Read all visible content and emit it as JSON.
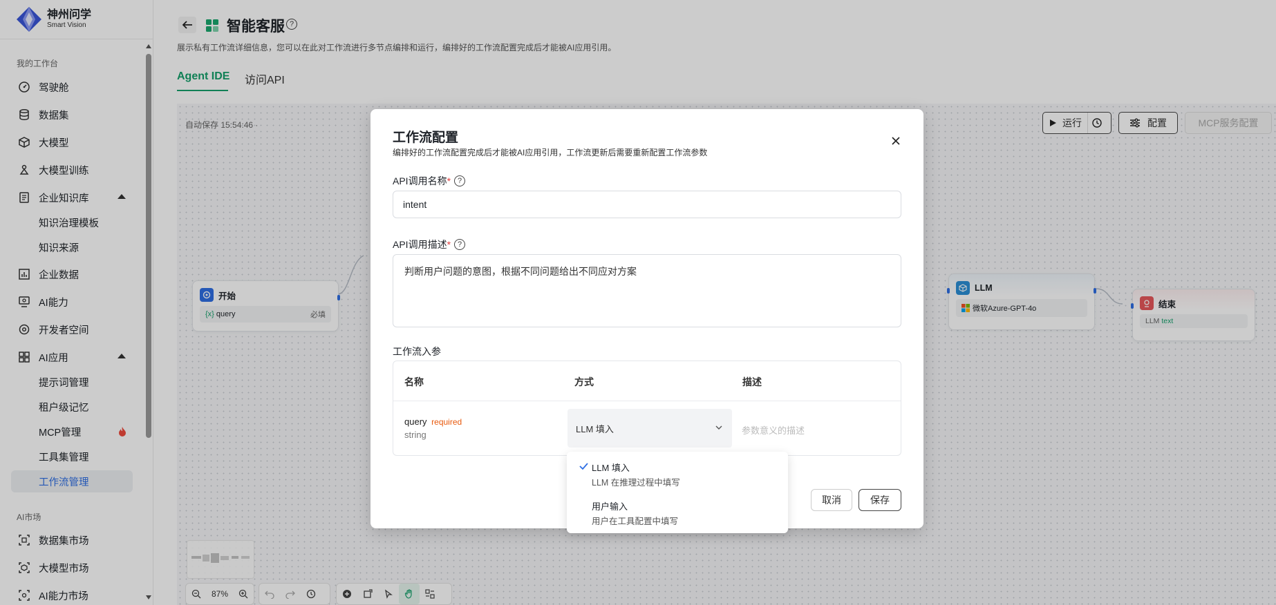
{
  "brand": {
    "name_cn": "神州问学",
    "name_en": "Smart Vision"
  },
  "sidebar": {
    "section_workbench": "我的工作台",
    "items": [
      {
        "label": "驾驶舱",
        "icon": "dashboard-icon"
      },
      {
        "label": "数据集",
        "icon": "database-icon"
      },
      {
        "label": "大模型",
        "icon": "cube-icon"
      },
      {
        "label": "大模型训练",
        "icon": "training-icon"
      },
      {
        "label": "企业知识库",
        "icon": "knowledge-icon",
        "expanded": true
      },
      {
        "label": "知识治理模板",
        "sub": true
      },
      {
        "label": "知识来源",
        "sub": true
      },
      {
        "label": "企业数据",
        "icon": "chart-icon"
      },
      {
        "label": "AI能力",
        "icon": "ai-ability-icon"
      },
      {
        "label": "开发者空间",
        "icon": "developer-icon"
      },
      {
        "label": "AI应用",
        "icon": "apps-icon",
        "expanded": true
      },
      {
        "label": "提示词管理",
        "sub": true
      },
      {
        "label": "租户级记忆",
        "sub": true
      },
      {
        "label": "MCP管理",
        "sub": true,
        "badge": "fire-icon"
      },
      {
        "label": "工具集管理",
        "sub": true
      },
      {
        "label": "工作流管理",
        "sub": true,
        "active": true
      }
    ],
    "section_market": "AI市场",
    "market": [
      {
        "label": "数据集市场",
        "icon": "dataset-market-icon"
      },
      {
        "label": "大模型市场",
        "icon": "model-market-icon"
      },
      {
        "label": "AI能力市场",
        "icon": "ability-market-icon"
      }
    ]
  },
  "header": {
    "title": "智能客服",
    "description": "展示私有工作流详细信息，您可以在此对工作流进行多节点编排和运行，编排好的工作流配置完成后才能被AI应用引用。",
    "tabs": [
      {
        "label": "Agent IDE",
        "active": true
      },
      {
        "label": "访问API",
        "active": false
      }
    ]
  },
  "canvas": {
    "autosave": "自动保存 15:54:46 ·",
    "toolbar": {
      "run": "运行",
      "config": "配置",
      "mcp": "MCP服务配置"
    },
    "nodes": {
      "start": {
        "title": "开始",
        "param": "query",
        "tag": "必填",
        "param_prefix": "{x}"
      },
      "llm": {
        "title": "LLM",
        "model": "微软Azure-GPT-4o"
      },
      "end": {
        "title": "结束",
        "output_src": "LLM",
        "output_var": "text"
      }
    },
    "zoom": "87%"
  },
  "modal": {
    "title": "工作流配置",
    "subtitle": "编排好的工作流配置完成后才能被AI应用引用，工作流更新后需要重新配置工作流参数",
    "api_name_label": "API调用名称",
    "api_name_value": "intent",
    "api_desc_label": "API调用描述",
    "api_desc_value": "判断用户问题的意图，根据不同问题给出不同应对方案",
    "params_label": "工作流入参",
    "table": {
      "headers": [
        "名称",
        "方式",
        "描述"
      ],
      "row": {
        "name": "query",
        "required": "required",
        "type": "string",
        "mode": "LLM 填入",
        "desc_placeholder": "参数意义的描述"
      }
    },
    "cancel": "取消",
    "save": "保存",
    "dropdown": [
      {
        "title": "LLM 填入",
        "desc": "LLM 在推理过程中填写",
        "selected": true
      },
      {
        "title": "用户输入",
        "desc": "用户在工具配置中填写",
        "selected": false
      }
    ]
  },
  "colors": {
    "accent": "#14a06b",
    "active_nav": "#2f6fe4",
    "required": "#e8590c",
    "danger": "#e03c3c"
  }
}
